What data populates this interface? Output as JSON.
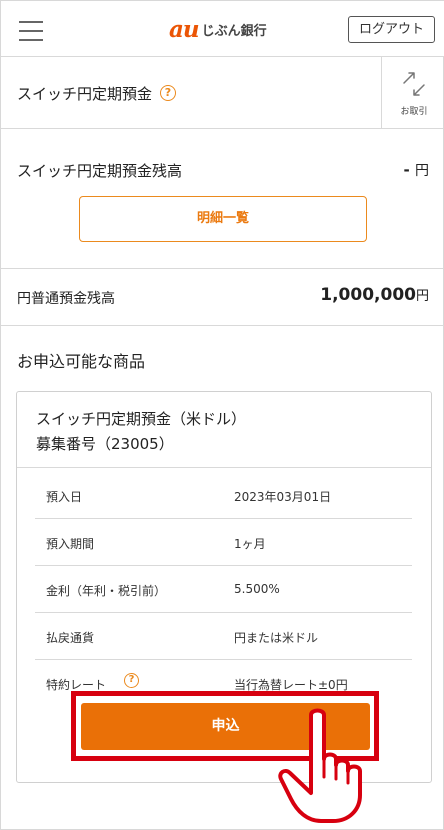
{
  "header": {
    "logo_mark": "au",
    "logo_text": "じぶん銀行",
    "logout_label": "ログアウト",
    "brand_color": "#eb5505"
  },
  "product": {
    "title": "スイッチ円定期預金",
    "help_glyph": "?",
    "transact_label": "お取引"
  },
  "balance": {
    "label": "スイッチ円定期預金残高",
    "value": "-",
    "unit": "円",
    "detail_button": "明細一覧"
  },
  "yen_balance": {
    "label": "円普通預金残高",
    "value": "1,000,000",
    "unit": "円"
  },
  "available": {
    "title": "お申込可能な商品",
    "card": {
      "name": "スイッチ円定期預金（米ドル）",
      "number": "募集番号（23005）",
      "rows": [
        {
          "label": "預入日",
          "value": "2023年03月01日"
        },
        {
          "label": "預入期間",
          "value": "1ヶ月"
        },
        {
          "label": "金利（年利・税引前）",
          "value": "5.500%"
        },
        {
          "label": "払戻通貨",
          "value": "円または米ドル"
        },
        {
          "label": "特約レート",
          "value": "当行為替レート±0円"
        }
      ],
      "apply_label": "申込"
    }
  },
  "colors": {
    "accent_orange": "#ea7007",
    "highlight_red": "#d7000f"
  }
}
